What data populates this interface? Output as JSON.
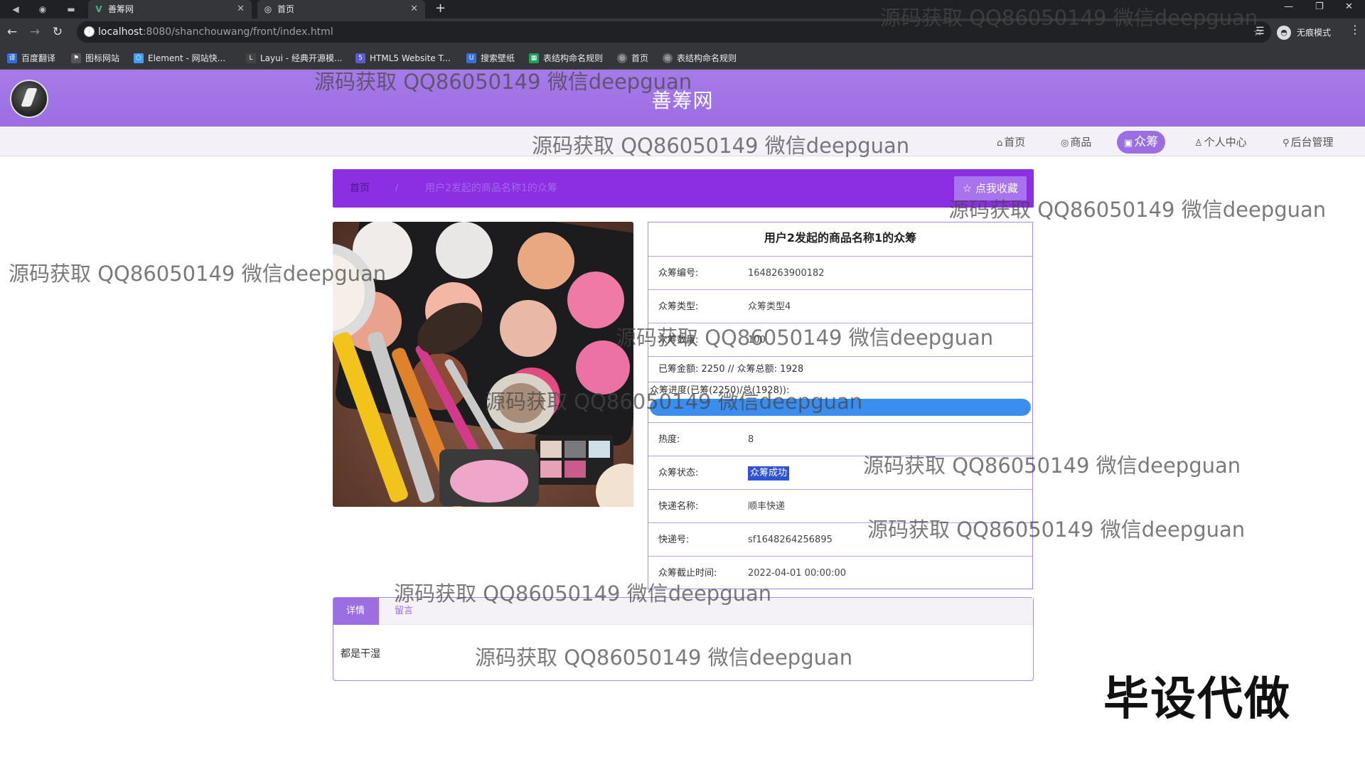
{
  "browser": {
    "tabs": [
      {
        "title": "善筹网",
        "favicon": "vue-icon"
      },
      {
        "title": "首页",
        "favicon": "globe-icon"
      }
    ],
    "url_host": "localhost",
    "url_rest": ":8080/shanchouwang/front/index.html",
    "profile_label": "无痕模式",
    "bookmarks": [
      {
        "label": "百度翻译",
        "color": "#2a6ee8"
      },
      {
        "label": "图标网站",
        "color": "#555555"
      },
      {
        "label": "Element - 网站快...",
        "color": "#409eff"
      },
      {
        "label": "Layui - 经典开源模...",
        "color": "#444444"
      },
      {
        "label": "HTML5 Website T...",
        "color": "#5b5bd6"
      },
      {
        "label": "搜索壁纸",
        "color": "#3a6fd8"
      },
      {
        "label": "表结构命名规则",
        "color": "#1aa260"
      },
      {
        "label": "首页",
        "color": "#666666"
      },
      {
        "label": "表结构命名规则",
        "color": "#666666"
      }
    ]
  },
  "site": {
    "title": "善筹网",
    "nav": [
      {
        "label": "首页",
        "icon": "home-icon"
      },
      {
        "label": "商品",
        "icon": "palette-icon"
      },
      {
        "label": "众筹",
        "icon": "gift-icon",
        "active": true
      },
      {
        "label": "个人中心",
        "icon": "user-icon"
      },
      {
        "label": "后台管理",
        "icon": "link-icon"
      }
    ]
  },
  "breadcrumb": {
    "home": "首页",
    "separator": "/",
    "current": "用户2发起的商品名称1的众筹",
    "favorite_label": "点我收藏"
  },
  "detail": {
    "title": "用户2发起的商品名称1的众筹",
    "rows": {
      "number": {
        "label": "众筹编号:",
        "value": "1648263900182"
      },
      "type": {
        "label": "众筹类型:",
        "value": "众筹类型4"
      },
      "count": {
        "label": "众筹数量:",
        "value": "100"
      },
      "amounts": {
        "label": "已筹金额: 2250 // 众筹总额: 1928"
      },
      "progress": {
        "label": "众筹进度(已筹(2250)/总(1928)):",
        "raised": 2250,
        "total": 1928
      },
      "heat": {
        "label": "热度:",
        "value": "8"
      },
      "status": {
        "label": "众筹状态:",
        "value": "众筹成功"
      },
      "courier": {
        "label": "快递名称:",
        "value": "顺丰快递"
      },
      "tracking": {
        "label": "快递号:",
        "value": "sf1648264256895"
      },
      "deadline": {
        "label": "众筹截止时间:",
        "value": "2022-04-01 00:00:00"
      }
    }
  },
  "tabs": {
    "items": [
      "详情",
      "留言"
    ],
    "content": "都是干湿"
  },
  "watermark": "源码获取 QQ86050149 微信deepguan",
  "corner_text": "毕设代做"
}
